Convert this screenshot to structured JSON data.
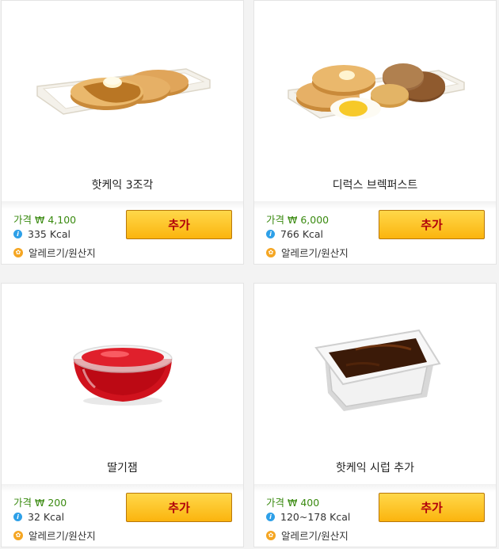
{
  "products": [
    {
      "name": "핫케익 3조각",
      "price_label": "가격",
      "price": "₩ 4,100",
      "kcal": "335 Kcal",
      "allergy": "알레르기/원산지",
      "button": "추가",
      "image": "hotcake-3pc-photo"
    },
    {
      "name": "디럭스 브렉퍼스트",
      "price_label": "가격",
      "price": "₩ 6,000",
      "kcal": "766 Kcal",
      "allergy": "알레르기/원산지",
      "button": "추가",
      "image": "deluxe-breakfast-photo"
    },
    {
      "name": "딸기잼",
      "price_label": "가격",
      "price": "₩ 200",
      "kcal": "32 Kcal",
      "allergy": "알레르기/원산지",
      "button": "추가",
      "image": "strawberry-jam-photo"
    },
    {
      "name": "핫케익 시럽 추가",
      "price_label": "가격",
      "price": "₩ 400",
      "kcal": "120~178 Kcal",
      "allergy": "알레르기/원산지",
      "button": "추가",
      "image": "hotcake-syrup-photo"
    }
  ],
  "colors": {
    "price_green": "#3a8a10",
    "button_yellow": "#fbb40e",
    "button_text_red": "#b1000b",
    "info_icon_blue": "#2ea0e8",
    "allergy_icon_orange": "#f5a623"
  }
}
